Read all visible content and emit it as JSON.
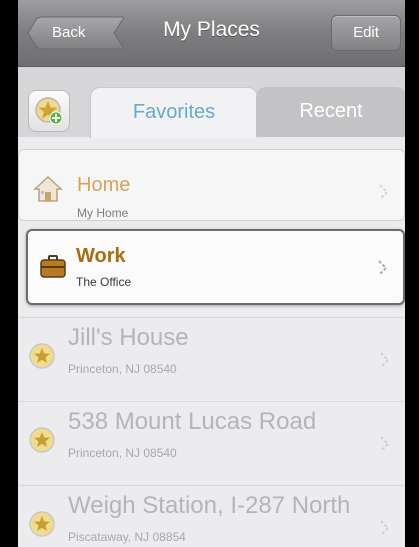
{
  "nav": {
    "title": "My Places",
    "back_label": "Back",
    "edit_label": "Edit"
  },
  "tabs": {
    "active_label": "Favorites",
    "inactive_label": "Recent",
    "add_icon": "add-favorite-icon"
  },
  "favorites": [
    {
      "title": "Home",
      "subtitle": "My Home",
      "icon": "house-icon",
      "color": "#d9a25a"
    },
    {
      "title": "Work",
      "subtitle": "The Office",
      "icon": "briefcase-icon",
      "color": "#a86d12"
    }
  ],
  "places": [
    {
      "title": "Jill's House",
      "subtitle": "Princeton, NJ 08540",
      "icon": "star-icon"
    },
    {
      "title": "538 Mount Lucas Road",
      "subtitle": "Princeton, NJ 08540",
      "icon": "star-icon"
    },
    {
      "title": "Weigh Station, I-287 North",
      "subtitle": "Piscataway, NJ 08854",
      "icon": "star-icon"
    }
  ],
  "colors": {
    "nav_bg": "#7e7e80",
    "tab_active_text": "#6aa9c9",
    "star": "#e8c14a"
  }
}
